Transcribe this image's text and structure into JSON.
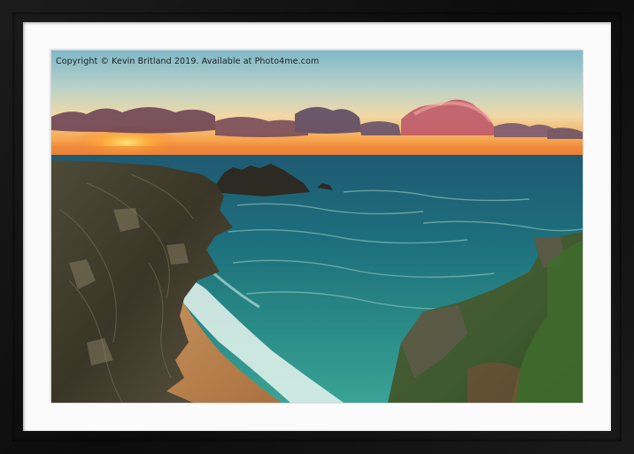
{
  "image": {
    "watermark_text": "Copyright © Kevin Britland 2019. Available at Photo4me.com",
    "frame_color": "#141414",
    "mount_color": "#fbfbfb"
  }
}
